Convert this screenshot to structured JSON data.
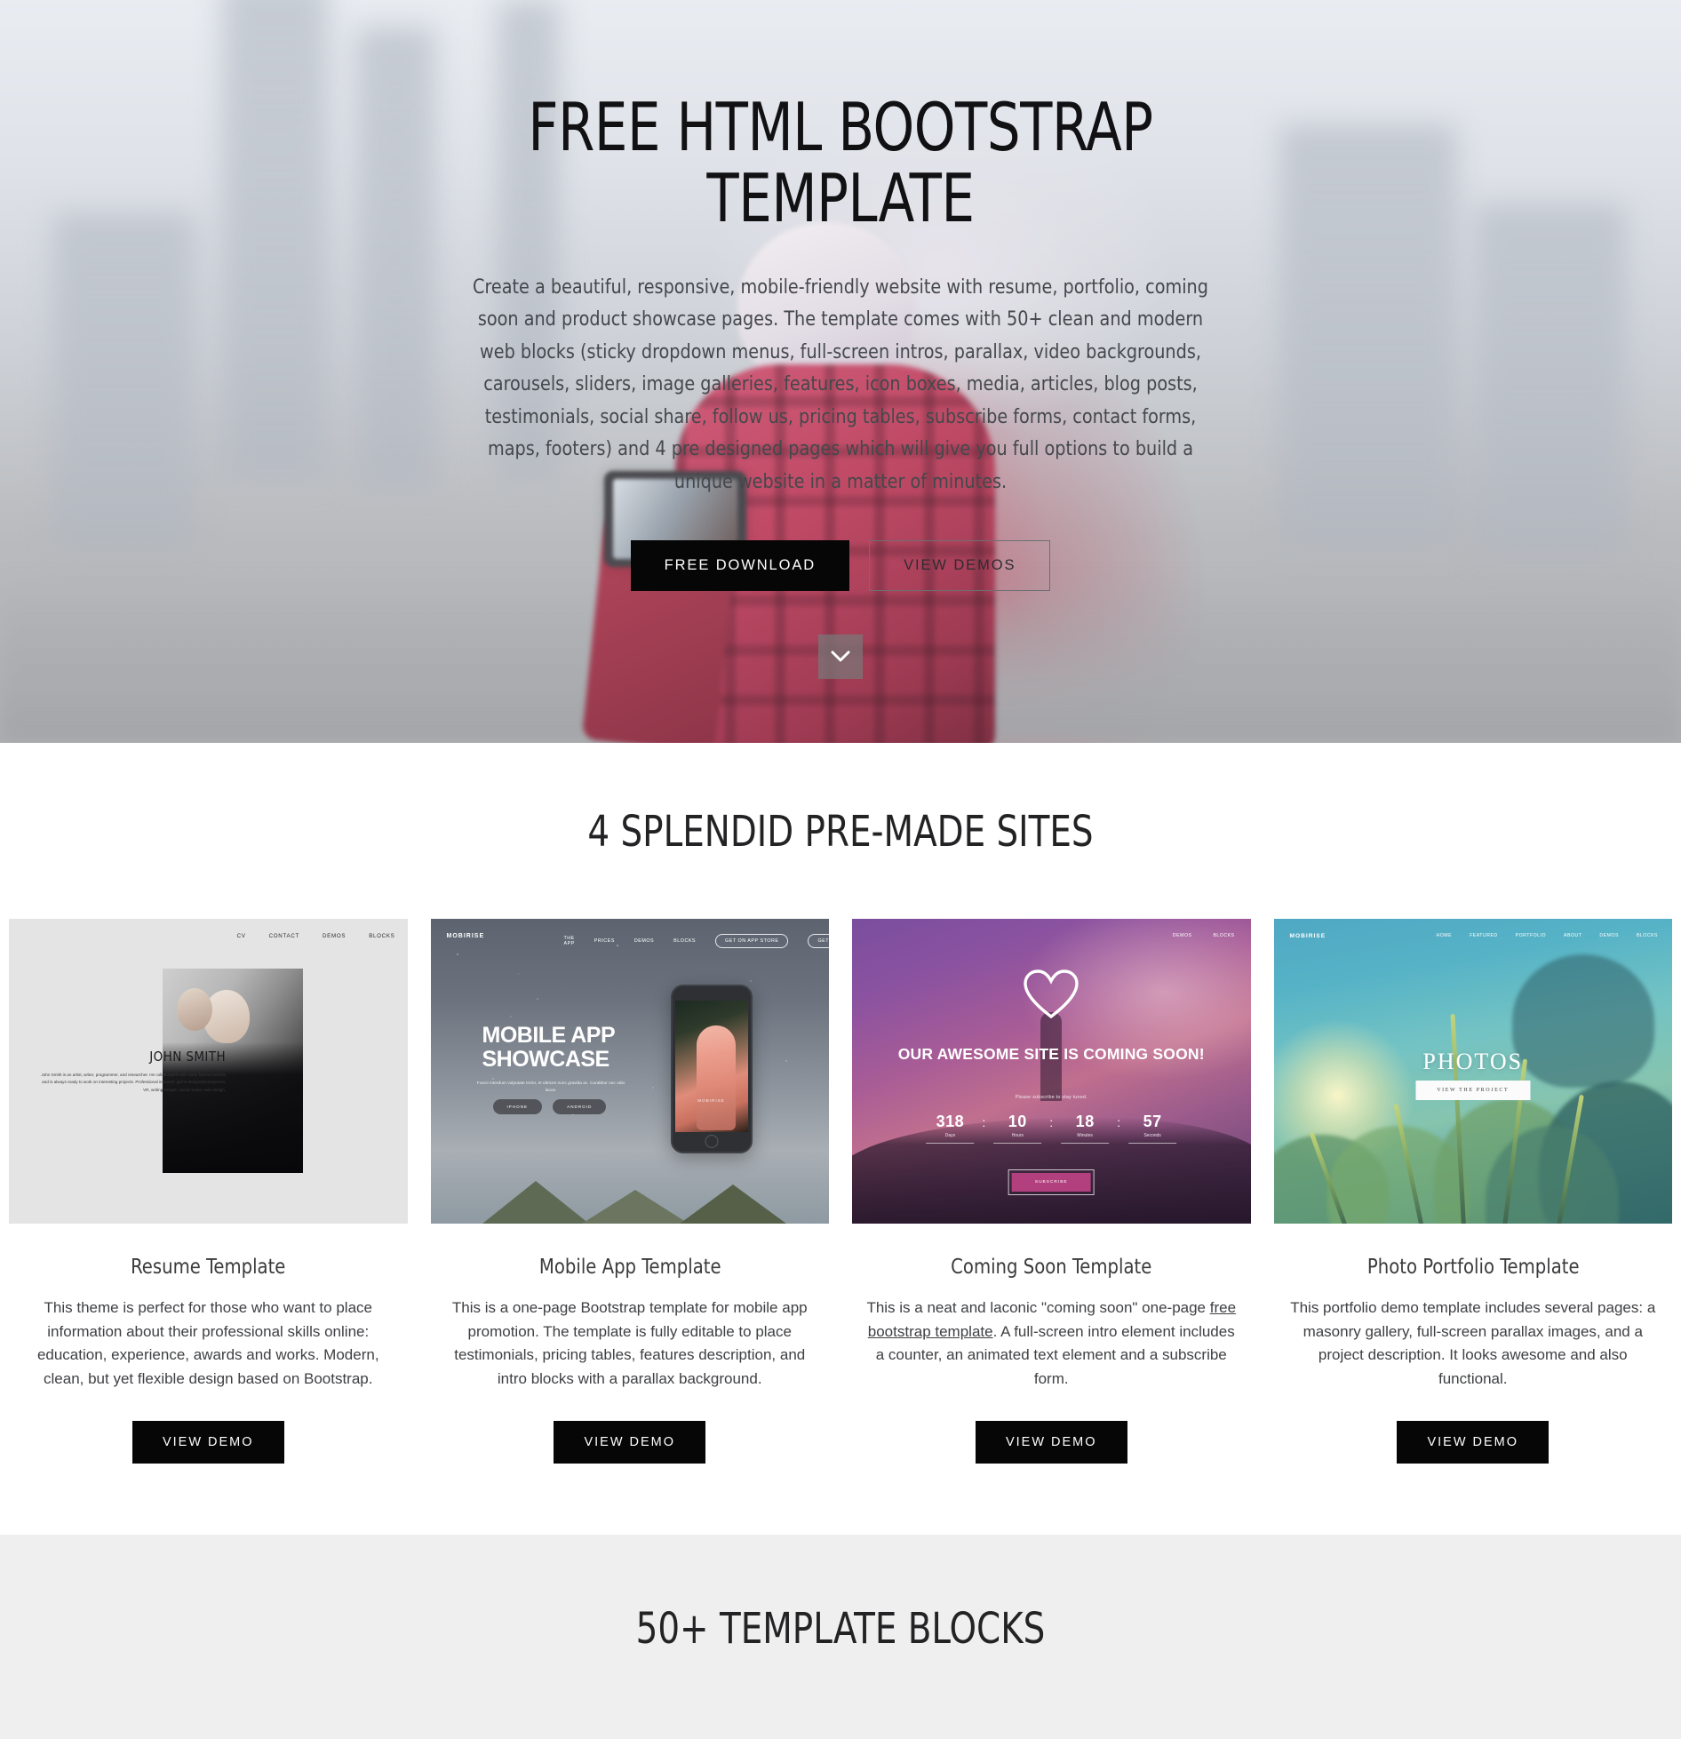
{
  "hero": {
    "title": "FREE HTML BOOTSTRAP TEMPLATE",
    "subtitle": "Create a beautiful, responsive, mobile-friendly website with resume, portfolio, coming soon and product showcase pages. The template comes with 50+ clean and modern web blocks (sticky dropdown menus, full-screen intros, parallax, video backgrounds, carousels, sliders, image galleries, features, icon boxes, media, articles, blog posts, testimonials, social share, follow us, pricing tables, subscribe forms, contact forms, maps, footers) and 4 pre designed pages which will give you full options to build a unique website in a matter of minutes.",
    "primary_button": "FREE DOWNLOAD",
    "secondary_button": "VIEW DEMOS",
    "scroll_icon": "chevron-down-icon"
  },
  "sites": {
    "heading": "4 SPLENDID PRE-MADE SITES",
    "cards": [
      {
        "title": "Resume Template",
        "desc": "This theme is perfect for those who want to place information about their professional skills online: education, experience, awards and works. Modern, clean, but yet flexible design based on Bootstrap.",
        "cta": "VIEW DEMO",
        "preview": {
          "nav": [
            "CV",
            "CONTACT",
            "DEMOS",
            "BLOCKS"
          ],
          "name": "JOHN SMITH",
          "blurb": "John Smith is an artist, writer, programmer, and researcher. He collaborated with many famous brands and is always ready to work on interesting projects. Professional interests: game design/development, VR, writing essays, social media, web design."
        }
      },
      {
        "title": "Mobile App Template",
        "desc": "This is a one-page Bootstrap template for mobile app promotion. The template is fully editable to place testimonials, pricing tables, features description, and intro blocks with a parallax background.",
        "cta": "VIEW DEMO",
        "preview": {
          "logo": "MOBIRISE",
          "nav": [
            "THE APP",
            "PRICES",
            "DEMOS",
            "BLOCKS"
          ],
          "store_buttons": [
            "GET ON APP STORE",
            "GET ON PLAY MARKET"
          ],
          "headline": "MOBILE APP SHOWCASE",
          "sub": "Fusce interdum vulputate tortor, et ultrices nunc gravida ac. Curabitur nec odio lacus.",
          "buttons": [
            "IPHONE",
            "ANDROID"
          ],
          "phone_brand": "MOBIRISE"
        }
      },
      {
        "title": "Coming Soon Template",
        "desc_before": "This is a neat and laconic \"coming soon\" one-page ",
        "desc_link": "free bootstrap template",
        "desc_after": ". A full-screen intro element includes a counter, an animated text element and a subscribe form.",
        "cta": "VIEW DEMO",
        "preview": {
          "nav": [
            "DEMOS",
            "BLOCKS"
          ],
          "icon": "heart-icon",
          "headline": "OUR  AWESOME SITE IS COMING SOON!",
          "sub": "Please subscribe to stay tuned.",
          "counter": [
            {
              "value": "318",
              "label": "Days"
            },
            {
              "value": "10",
              "label": "Hours"
            },
            {
              "value": "18",
              "label": "Minutes"
            },
            {
              "value": "57",
              "label": "Seconds"
            }
          ],
          "separator": ":",
          "subscribe": "SUBSCRIBE"
        }
      },
      {
        "title": "Photo Portfolio Template",
        "desc": "This portfolio demo template includes several pages: a masonry gallery, full-screen parallax images, and a project description. It looks awesome and also functional.",
        "cta": "VIEW DEMO",
        "preview": {
          "logo": "MOBIRISE",
          "nav": [
            "HOME",
            "FEATURED",
            "PORTFOLIO",
            "ABOUT",
            "DEMOS",
            "BLOCKS"
          ],
          "headline": "PHOTOS",
          "cta": "VIEW THE PROJECT"
        }
      }
    ]
  },
  "blocks": {
    "heading": "50+ TEMPLATE BLOCKS"
  },
  "colors": {
    "button_dark": "#060606",
    "section_gray": "#efefef",
    "text_dark": "#232325",
    "text_body": "#3f4043"
  }
}
